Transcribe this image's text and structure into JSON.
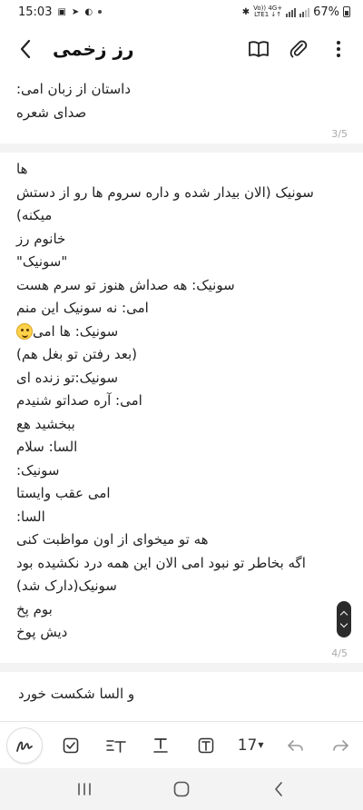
{
  "status_bar": {
    "time": "15:03",
    "network_top": "Vo)) 4G+",
    "network_bottom": "LTE1 ↓↑",
    "battery": "67%"
  },
  "header": {
    "title": "رز زخمی"
  },
  "pages": [
    {
      "number": "3/5",
      "lines": [
        "داستان از زبان امی:",
        "صدای شعره"
      ]
    },
    {
      "number": "4/5",
      "lines": [
        "ها",
        "سونیک (الان بیدار شده و داره سروم ها رو از دستش",
        "میکنه)",
        "خانوم رز",
        "\"سونیک\"",
        "سونیک: هه صداش هنوز تو سرم هست",
        "امی: نه سونیک این منم",
        "سونیک: ها امی",
        "(بعد رفتن تو بغل هم)",
        "سونیک:تو زنده ای",
        "امی: آره صداتو شنیدم",
        "ببخشید هع",
        "السا: سلام",
        "سونیک:",
        "امی عقب وایستا",
        "السا:",
        "هه تو میخوای از اون مواظبت کنی",
        "اگه بخاطر تو نبود امی الان این همه درد نکشیده بود",
        "سونیک(دارک شد)",
        "بوم پخ",
        "دیش پوخ"
      ]
    },
    {
      "lines": [
        "و السا شکست خورد"
      ]
    }
  ],
  "toolbar": {
    "font_size": "17"
  },
  "icons": {
    "pen": "handwriting-pen-icon",
    "checkbox": "checkbox-icon",
    "text_style": "text-style-icon",
    "underline": "underline-icon",
    "text_box": "text-box-icon",
    "undo": "undo-icon",
    "redo": "redo-icon",
    "emoji": "grimacing-face-emoji"
  }
}
